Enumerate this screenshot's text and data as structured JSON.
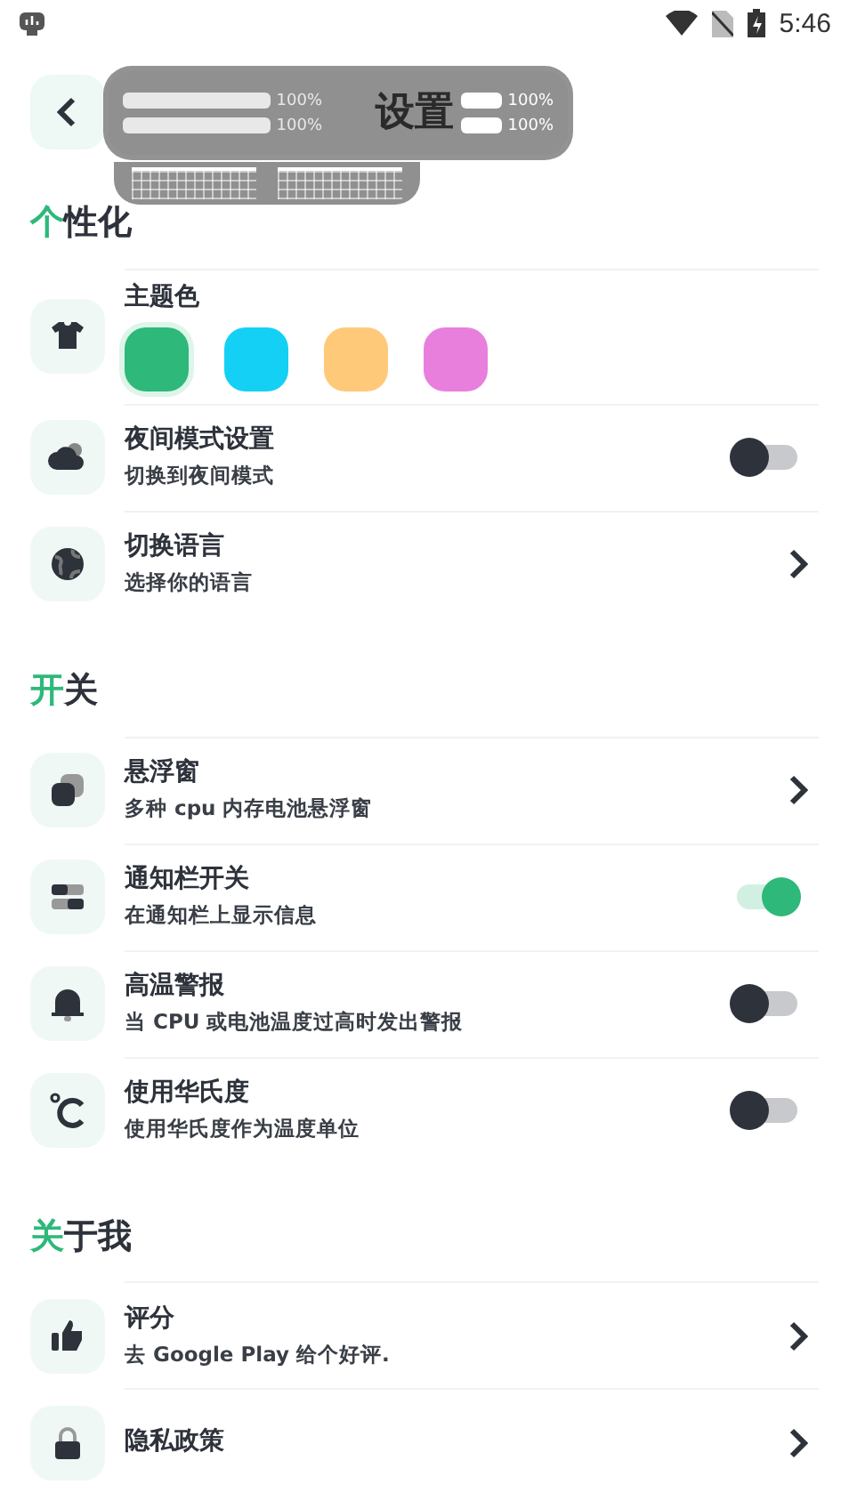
{
  "status_bar": {
    "time": "5:46"
  },
  "header": {
    "title": "设置"
  },
  "floating_widget": {
    "meters": [
      {
        "reading": "100%",
        "level": 1,
        "faded": true
      },
      {
        "reading": "100%",
        "level": 1,
        "faded": false
      },
      {
        "reading": "100%",
        "level": 1,
        "faded": true
      },
      {
        "reading": "100%",
        "level": 1,
        "faded": false
      }
    ]
  },
  "sections": [
    {
      "accent": "个",
      "heading": "性化",
      "rows": [
        {
          "kind": "colors",
          "title": "主题色",
          "colors": [
            {
              "color": "#2eb87a",
              "selected": true
            },
            {
              "color": "#14d0f5",
              "selected": false
            },
            {
              "color": "#ffc97a",
              "selected": false
            },
            {
              "color": "#e97fdd",
              "selected": false
            }
          ]
        },
        {
          "kind": "toggle",
          "title": "夜间模式设置",
          "subtitle": "切换到夜间模式",
          "on": false
        },
        {
          "kind": "link",
          "title": "切换语言",
          "subtitle": "选择你的语言"
        }
      ]
    },
    {
      "accent": "开",
      "heading": "关",
      "rows": [
        {
          "kind": "link",
          "title": "悬浮窗",
          "subtitle": "多种 cpu 内存电池悬浮窗"
        },
        {
          "kind": "toggle",
          "title": "通知栏开关",
          "subtitle": "在通知栏上显示信息",
          "on": true
        },
        {
          "kind": "toggle",
          "title": "高温警报",
          "subtitle": "当 CPU 或电池温度过高时发出警报",
          "on": false
        },
        {
          "kind": "toggle",
          "title": "使用华氏度",
          "subtitle": "使用华氏度作为温度单位",
          "on": false
        }
      ]
    },
    {
      "accent": "关",
      "heading": "于我",
      "rows": [
        {
          "kind": "link",
          "title": "评分",
          "subtitle": "去 Google Play 给个好评."
        },
        {
          "kind": "link",
          "title": "隐私政策"
        }
      ]
    }
  ]
}
